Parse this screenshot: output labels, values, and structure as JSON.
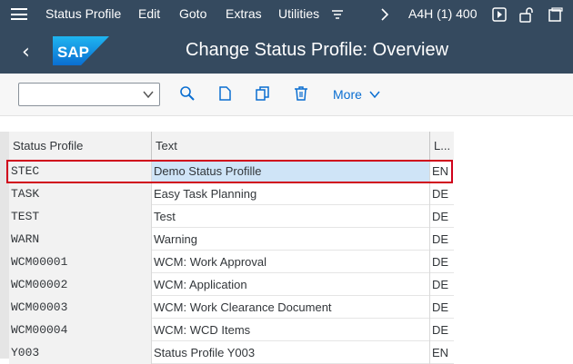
{
  "menubar": {
    "items": [
      {
        "label": "Status Profile"
      },
      {
        "label": "Edit"
      },
      {
        "label": "Goto"
      },
      {
        "label": "Extras"
      },
      {
        "label": "Utilities"
      }
    ],
    "system": "A4H (1) 400"
  },
  "header": {
    "title": "Change Status Profile: Overview",
    "logo_text": "SAP"
  },
  "toolbar": {
    "dropdown_value": "",
    "more_label": "More"
  },
  "table": {
    "columns": [
      "Status Profile",
      "Text",
      "L..."
    ],
    "rows": [
      {
        "profile": "STEC",
        "text": "Demo Status Profille",
        "lang": "EN",
        "selected": true
      },
      {
        "profile": "TASK",
        "text": "Easy Task Planning",
        "lang": "DE"
      },
      {
        "profile": "TEST",
        "text": "Test",
        "lang": "DE"
      },
      {
        "profile": "WARN",
        "text": "Warning",
        "lang": "DE"
      },
      {
        "profile": "WCM00001",
        "text": "WCM: Work Approval",
        "lang": "DE"
      },
      {
        "profile": "WCM00002",
        "text": "WCM: Application",
        "lang": "DE"
      },
      {
        "profile": "WCM00003",
        "text": "WCM: Work Clearance Document",
        "lang": "DE"
      },
      {
        "profile": "WCM00004",
        "text": "WCM: WCD Items",
        "lang": "DE"
      },
      {
        "profile": "Y003",
        "text": "Status Profile Y003",
        "lang": "EN"
      }
    ]
  },
  "colors": {
    "shell": "#354a5f",
    "accent": "#0a6ed1",
    "selection": "#cfe4f7",
    "highlight_box": "#d0021b"
  },
  "icons": [
    "menu-icon",
    "command-field-icon",
    "chevron-right-icon",
    "execute-icon",
    "unlock-icon",
    "more-window-icon",
    "back-icon",
    "find-icon",
    "new-document-icon",
    "copy-icon",
    "delete-icon",
    "chevron-down-icon"
  ]
}
